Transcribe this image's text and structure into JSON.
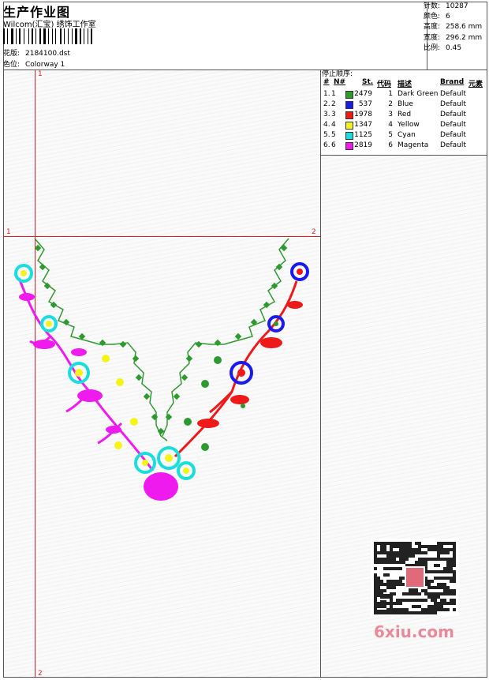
{
  "header": {
    "title": "生产作业图",
    "company": "Wilcom(汇宝) 绣饰工作室",
    "design_label": "花版:",
    "design_value": "2184100.dst",
    "colorway_label": "色位:",
    "colorway_value": "Colorway 1"
  },
  "stats": [
    {
      "label": "针数:",
      "value": "10287"
    },
    {
      "label": "颜色:",
      "value": "6"
    },
    {
      "label": "高度:",
      "value": "258.6 mm"
    },
    {
      "label": "宽度:",
      "value": "296.2 mm"
    },
    {
      "label": "比例:",
      "value": "0.45"
    }
  ],
  "stop_sequence": {
    "title": "停止顺序:",
    "columns": {
      "hash": "#",
      "no": "N#",
      "st": "St.",
      "code": "代码",
      "desc": "描述",
      "brand": "Brand",
      "element": "元素"
    },
    "rows": [
      {
        "idx": "1.",
        "no": "1",
        "color": "#2e9a2e",
        "st": "2479",
        "code": "1",
        "desc": "Dark Green",
        "brand": "Default"
      },
      {
        "idx": "2.",
        "no": "2",
        "color": "#1a1aee",
        "st": "537",
        "code": "2",
        "desc": "Blue",
        "brand": "Default"
      },
      {
        "idx": "3.",
        "no": "3",
        "color": "#ee1a1a",
        "st": "1978",
        "code": "3",
        "desc": "Red",
        "brand": "Default"
      },
      {
        "idx": "4.",
        "no": "4",
        "color": "#f4f41a",
        "st": "1347",
        "code": "4",
        "desc": "Yellow",
        "brand": "Default"
      },
      {
        "idx": "5.",
        "no": "5",
        "color": "#1adede",
        "st": "1125",
        "code": "5",
        "desc": "Cyan",
        "brand": "Default"
      },
      {
        "idx": "6.",
        "no": "6",
        "color": "#ee1aee",
        "st": "2819",
        "code": "6",
        "desc": "Magenta",
        "brand": "Default"
      }
    ]
  },
  "axes": {
    "top_left": "1",
    "left_top": "1",
    "right": "2",
    "bottom": "2"
  },
  "watermark": "6xiu.com",
  "colors": {
    "guide_line": "#e02020",
    "border": "#555555"
  }
}
